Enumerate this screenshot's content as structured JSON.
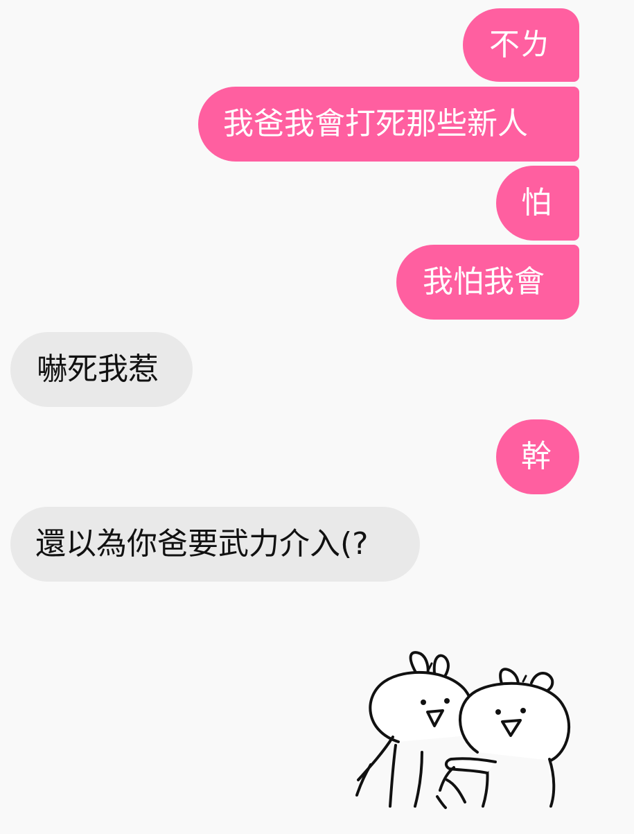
{
  "messages": [
    {
      "side": "sent",
      "text": "不ㄌ"
    },
    {
      "side": "sent",
      "text": "我爸我會打死那些新人"
    },
    {
      "side": "sent",
      "text": "怕"
    },
    {
      "side": "sent",
      "text": "我怕我會"
    },
    {
      "side": "received",
      "text": "嚇死我惹"
    },
    {
      "side": "sent",
      "text": "幹"
    },
    {
      "side": "received",
      "text": "還以為你爸要武力介入(?"
    }
  ],
  "sticker": {
    "icon": "two-rabbits-hugging-sticker"
  },
  "colors": {
    "background": "#f9f9f9",
    "sent_bubble": "#ff5fa0",
    "received_bubble": "#e9e9e9",
    "sent_text": "#ffffff",
    "received_text": "#111111"
  }
}
